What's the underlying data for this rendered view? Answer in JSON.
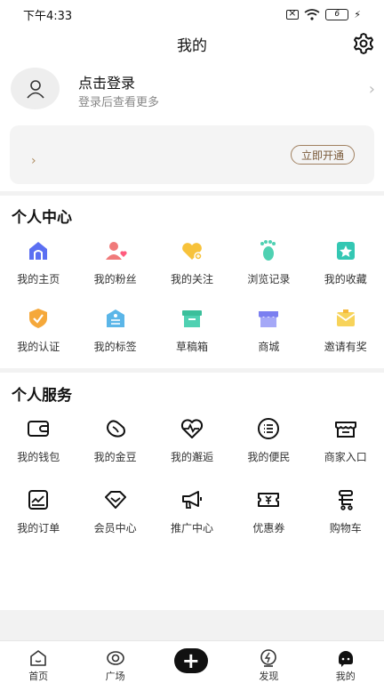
{
  "status_bar": {
    "time": "下午4:33",
    "battery": "6"
  },
  "header": {
    "title": "我的"
  },
  "login": {
    "title": "点击登录",
    "subtitle": "登录后查看更多",
    "chevron": "›"
  },
  "vip": {
    "chevron": "›",
    "button": "立即开通"
  },
  "personal_center": {
    "title": "个人中心",
    "items": [
      {
        "label": "我的主页",
        "icon": "home-icon"
      },
      {
        "label": "我的粉丝",
        "icon": "fans-icon"
      },
      {
        "label": "我的关注",
        "icon": "follow-heart-icon"
      },
      {
        "label": "浏览记录",
        "icon": "footprint-icon"
      },
      {
        "label": "我的收藏",
        "icon": "star-icon"
      },
      {
        "label": "我的认证",
        "icon": "shield-check-icon"
      },
      {
        "label": "我的标签",
        "icon": "tag-icon"
      },
      {
        "label": "草稿箱",
        "icon": "draft-box-icon"
      },
      {
        "label": "商城",
        "icon": "shop-icon"
      },
      {
        "label": "邀请有奖",
        "icon": "invite-envelope-icon"
      }
    ]
  },
  "personal_services": {
    "title": "个人服务",
    "items": [
      {
        "label": "我的钱包",
        "icon": "wallet-icon"
      },
      {
        "label": "我的金豆",
        "icon": "bean-icon"
      },
      {
        "label": "我的邂逅",
        "icon": "heartbeat-icon"
      },
      {
        "label": "我的便民",
        "icon": "list-icon"
      },
      {
        "label": "商家入口",
        "icon": "store-icon"
      },
      {
        "label": "我的订单",
        "icon": "order-icon"
      },
      {
        "label": "会员中心",
        "icon": "diamond-icon"
      },
      {
        "label": "推广中心",
        "icon": "megaphone-icon"
      },
      {
        "label": "优惠券",
        "icon": "coupon-icon"
      },
      {
        "label": "购物车",
        "icon": "cart-icon"
      }
    ]
  },
  "tabbar": {
    "fab": "+",
    "tabs": [
      {
        "label": "首页",
        "icon": "home-tab-icon"
      },
      {
        "label": "广场",
        "icon": "square-tab-icon"
      },
      {
        "label": "",
        "icon": "add-icon"
      },
      {
        "label": "发现",
        "icon": "discover-tab-icon"
      },
      {
        "label": "我的",
        "icon": "mine-tab-icon"
      }
    ]
  },
  "colors": {
    "vip_button": "#a08060",
    "fab": "#111111",
    "separator": "#f2f2f2"
  }
}
